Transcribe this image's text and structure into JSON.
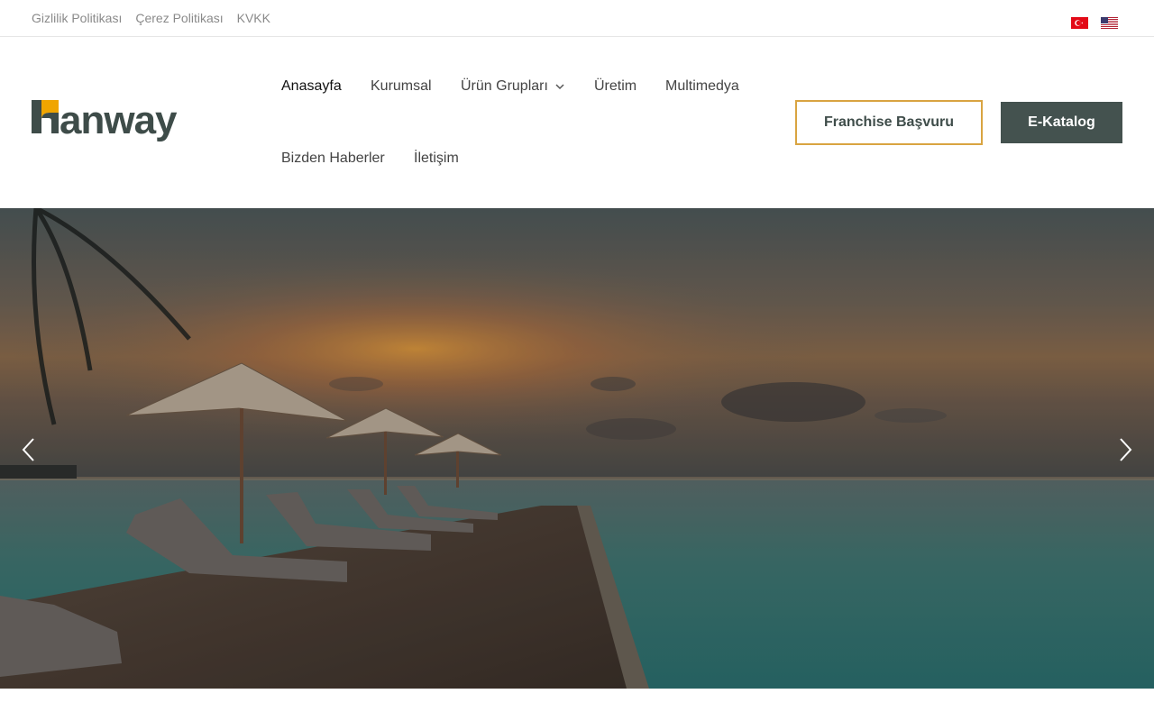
{
  "topbar": {
    "links": [
      {
        "label": "Gizlilik Politikası"
      },
      {
        "label": "Çerez Politikası"
      },
      {
        "label": "KVKK"
      }
    ],
    "flags": [
      "turkish-flag-icon",
      "us-flag-icon"
    ]
  },
  "brand": {
    "name": "hanway",
    "colors": {
      "accent": "#f0a500",
      "dark": "#3e4c49"
    }
  },
  "nav": {
    "items": [
      {
        "label": "Anasayfa",
        "active": true
      },
      {
        "label": "Kurumsal"
      },
      {
        "label": "Ürün Grupları",
        "has_dropdown": true
      },
      {
        "label": "Üretim"
      },
      {
        "label": "Multimedya"
      },
      {
        "label": "Bizden Haberler"
      },
      {
        "label": "İletişim"
      }
    ]
  },
  "actions": {
    "franchise_label": "Franchise Başvuru",
    "katalog_label": "E-Katalog",
    "colors": {
      "franchise_border": "#d9a441",
      "katalog_bg": "#44524f"
    }
  },
  "hero": {
    "icons": [
      "chevron-left-icon",
      "chevron-right-icon"
    ]
  }
}
